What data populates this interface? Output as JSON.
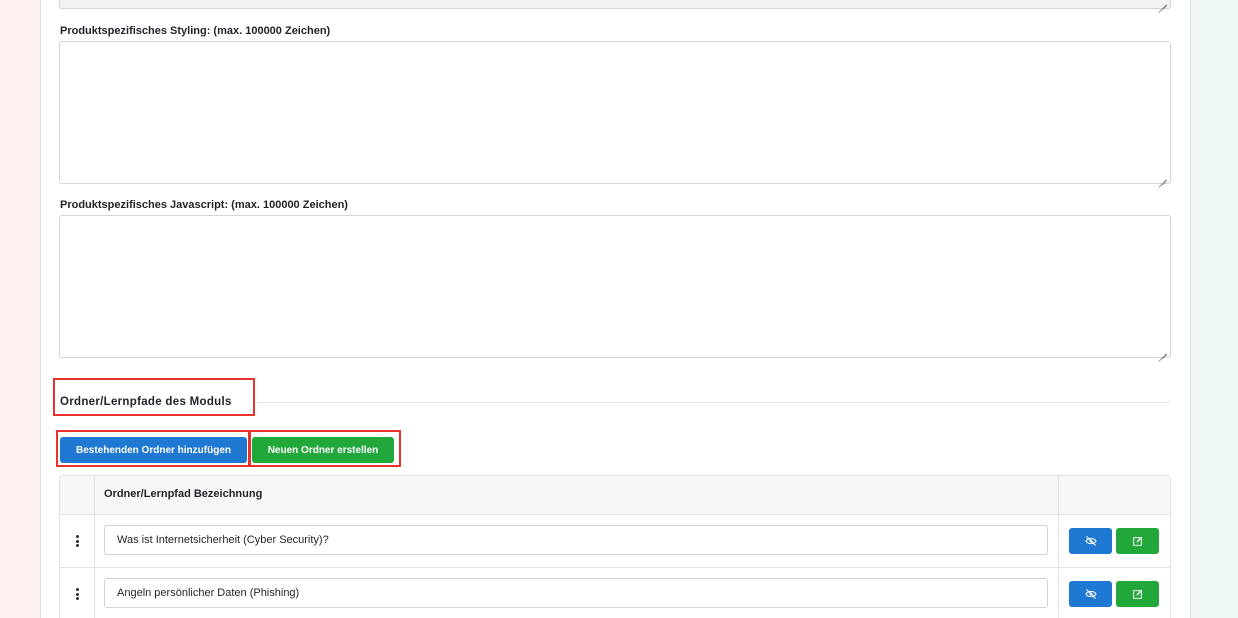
{
  "form": {
    "styling_label": "Produktspezifisches Styling: (max. 100000 Zeichen)",
    "styling_value": "",
    "javascript_label": "Produktspezifisches Javascript: (max. 100000 Zeichen)",
    "javascript_value": ""
  },
  "folders_section": {
    "title": "Ordner/Lernpfade des Moduls",
    "add_existing_button": "Bestehenden Ordner hinzufügen",
    "create_new_button": "Neuen Ordner erstellen"
  },
  "table": {
    "column_header": "Ordner/Lernpfad Bezeichnung",
    "rows": [
      {
        "name": "Was ist Internetsicherheit (Cyber Security)?"
      },
      {
        "name": "Angeln persönlicher Daten (Phishing)"
      }
    ],
    "row_icons": [
      "drag-handle-icon",
      "eye-slash-icon",
      "edit-icon"
    ]
  },
  "colors": {
    "primary": "#1f78d1",
    "success": "#22a73b",
    "highlight": "#e8322b"
  }
}
